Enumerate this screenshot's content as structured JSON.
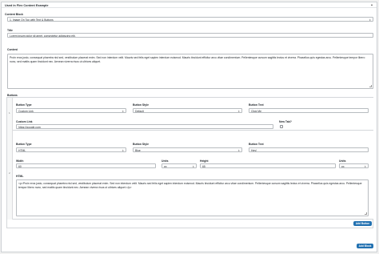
{
  "panel": {
    "title": "Used in Flex Content Example"
  },
  "content_block": {
    "label": "Content Block",
    "value": "1. Image On Top with Text & Buttons"
  },
  "title_field": {
    "label": "Title",
    "value": "Lorem ipsum dolor sit amet, consectetur adipiscing elit."
  },
  "content_field": {
    "label": "Content",
    "value": "Proin eros justo, consequat pharetra nisl sed, vestibulum placerat enim. Sed non interdum velit. Mauris sed felis eget sapien interdum euismod. Mauris tincidunt efficitur arcu vitae condimentum. Pellentesque cursum sagittis lectus et viverra. Phasellus quis egestas arcu. Pellentesque tempor libero nunc, sed mattis quam tincidunt nec. Aenean viverra risus ut ultrices aliquet."
  },
  "buttons": {
    "label": "Buttons",
    "row1": {
      "num": "1",
      "button_type": {
        "label": "Button Type",
        "value": "Custom Link"
      },
      "button_style": {
        "label": "Button Style",
        "value": "Default"
      },
      "button_text": {
        "label": "Button Text",
        "value": "Click Me"
      },
      "custom_link": {
        "label": "Custom Link",
        "value": "https://google.com"
      },
      "new_tab": {
        "label": "New Tab?"
      }
    },
    "row2": {
      "num": "2",
      "button_type": {
        "label": "Button Type",
        "value": "HTML"
      },
      "button_style": {
        "label": "Button Style",
        "value": "Blue"
      },
      "button_text": {
        "label": "Button Text",
        "value": "Hey!"
      },
      "width": {
        "label": "Width",
        "value": "60"
      },
      "width_units": {
        "label": "Units",
        "value": "px"
      },
      "height": {
        "label": "Height",
        "value": "65"
      },
      "height_units": {
        "label": "Units",
        "value": "px"
      },
      "html": {
        "label": "HTML",
        "value": "<p>Proin eros justo, consequat pharetra nisl sed, vestibulum placerat enim. Sed non interdum velit. Mauris sed felis eget sapien interdum euismod. Mauris tincidunt efficitur arcu vitae condimentum. Pellentesque cursum sagittis lectus et viverra. Phasellus quis egestas arcu. Pellentesque tempor libero nunc, sed mattis quam tincidunt nec. Aenean viverra risus ut ultrices aliquet.</p>"
      }
    },
    "add_button_label": "Add Button"
  },
  "add_block_label": "Add Block",
  "icons": {
    "collapse": "chevron-up-icon",
    "select": "updown-arrows-icon",
    "resize": "resize-handle-icon"
  },
  "colors": {
    "accent": "#2271b1",
    "border": "#b8bcc0",
    "background": "#f1f1f1"
  }
}
